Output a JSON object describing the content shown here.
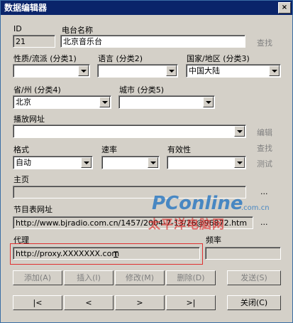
{
  "window": {
    "title": "数据编辑器",
    "close": "×"
  },
  "labels": {
    "id": "ID",
    "station_name": "电台名称",
    "genre": "性质/流派 (分类1)",
    "language": "语言 (分类2)",
    "country": "国家/地区 (分类3)",
    "province": "省/州 (分类4)",
    "city": "城市 (分类5)",
    "play_url": "播放网址",
    "format": "格式",
    "rate": "速率",
    "validity": "有效性",
    "homepage": "主页",
    "schedule_url": "节目表网址",
    "proxy": "代理",
    "frequency": "频率"
  },
  "fields": {
    "id": "21",
    "station_name": "北京音乐台",
    "genre": "",
    "language": "",
    "country": "中国大陆",
    "province": "北京",
    "city": "",
    "play_url": "",
    "format": "自动",
    "rate": "",
    "validity": "",
    "homepage": "",
    "schedule_url": "http://www.bjradio.com.cn/1457/2004-7-13/26@96872.htm",
    "proxy": "http://proxy.XXXXXXX.com",
    "frequency": ""
  },
  "side_links": {
    "find1": "查找",
    "edit": "编辑",
    "find2": "查找",
    "test": "测试",
    "more1": "...",
    "more2": "..."
  },
  "buttons": {
    "add": "添加(A)",
    "insert": "插入(I)",
    "modify": "修改(M)",
    "delete": "删除(D)",
    "send": "发送(S)",
    "first": "|<",
    "prev": "<",
    "next": ">",
    "last": ">|",
    "close": "关闭(C)"
  },
  "watermark": {
    "brand": "PConline",
    "domain": ".com.cn",
    "slogan": "太平洋电脑网"
  },
  "colors": {
    "title_bg": "#0a246a",
    "highlight_box": "#e03030",
    "watermark_blue": "#1a6fc0",
    "watermark_red": "#e02020"
  }
}
